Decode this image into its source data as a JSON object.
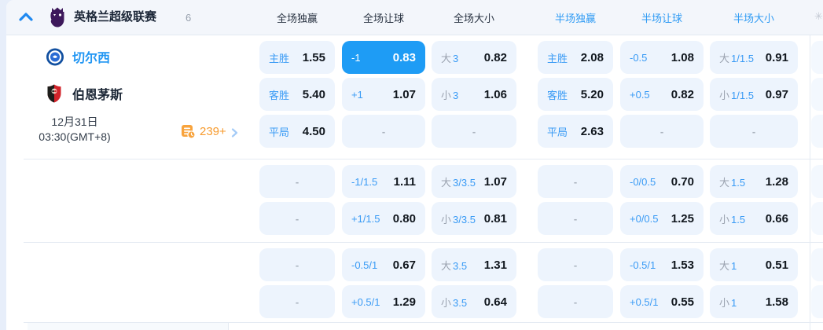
{
  "header": {
    "league_name": "英格兰超级联赛",
    "match_count": "6",
    "columns": [
      {
        "label": "全场独赢",
        "tone": "dark"
      },
      {
        "label": "全场让球",
        "tone": "dark"
      },
      {
        "label": "全场大小",
        "tone": "dark"
      },
      {
        "label": "半场独赢",
        "tone": "blue"
      },
      {
        "label": "半场让球",
        "tone": "blue"
      },
      {
        "label": "半场大小",
        "tone": "blue"
      }
    ]
  },
  "match": {
    "home_team": "切尔西",
    "away_team": "伯恩茅斯",
    "date": "12月31日",
    "time": "03:30(GMT+8)",
    "more_markets_count": "239+"
  },
  "odds": {
    "empty_label": "-",
    "rows": [
      [
        {
          "label": "主胜",
          "value": "1.55"
        },
        {
          "label": "-1",
          "value": "0.83",
          "highlight": true
        },
        {
          "prefix": "大",
          "label": "3",
          "value": "0.82"
        },
        {
          "label": "主胜",
          "value": "2.08"
        },
        {
          "label": "-0.5",
          "value": "1.08"
        },
        {
          "prefix": "大",
          "label": "1/1.5",
          "value": "0.91"
        }
      ],
      [
        {
          "label": "客胜",
          "value": "5.40"
        },
        {
          "label": "+1",
          "value": "1.07"
        },
        {
          "prefix": "小",
          "label": "3",
          "value": "1.06"
        },
        {
          "label": "客胜",
          "value": "5.20"
        },
        {
          "label": "+0.5",
          "value": "0.82"
        },
        {
          "prefix": "小",
          "label": "1/1.5",
          "value": "0.97"
        }
      ],
      [
        {
          "label": "平局",
          "value": "4.50"
        },
        {
          "empty": true
        },
        {
          "empty": true
        },
        {
          "label": "平局",
          "value": "2.63"
        },
        {
          "empty": true
        },
        {
          "empty": true
        }
      ],
      [
        {
          "empty": true
        },
        {
          "label": "-1/1.5",
          "value": "1.11"
        },
        {
          "prefix": "大",
          "label": "3/3.5",
          "value": "1.07"
        },
        {
          "empty": true
        },
        {
          "label": "-0/0.5",
          "value": "0.70"
        },
        {
          "prefix": "大",
          "label": "1.5",
          "value": "1.28"
        }
      ],
      [
        {
          "empty": true
        },
        {
          "label": "+1/1.5",
          "value": "0.80"
        },
        {
          "prefix": "小",
          "label": "3/3.5",
          "value": "0.81"
        },
        {
          "empty": true
        },
        {
          "label": "+0/0.5",
          "value": "1.25"
        },
        {
          "prefix": "小",
          "label": "1.5",
          "value": "0.66"
        }
      ],
      [
        {
          "empty": true
        },
        {
          "label": "-0.5/1",
          "value": "0.67"
        },
        {
          "prefix": "大",
          "label": "3.5",
          "value": "1.31"
        },
        {
          "empty": true
        },
        {
          "label": "-0.5/1",
          "value": "1.53"
        },
        {
          "prefix": "大",
          "label": "1",
          "value": "0.51"
        }
      ],
      [
        {
          "empty": true
        },
        {
          "label": "+0.5/1",
          "value": "1.29"
        },
        {
          "prefix": "小",
          "label": "3.5",
          "value": "0.64"
        },
        {
          "empty": true
        },
        {
          "label": "+0.5/1",
          "value": "0.55"
        },
        {
          "prefix": "小",
          "label": "1",
          "value": "1.58"
        }
      ]
    ]
  },
  "icons": {
    "collapse": "chevron-up-icon",
    "more_markets": "markets-list-clock-icon",
    "header_right": "settings-icon"
  },
  "colors": {
    "accent_blue": "#1e9cf5",
    "label_blue": "#3a9bf5",
    "header_bg": "#f3f6fb",
    "cell_bg": "#edf4fd",
    "orange": "#f79b2e",
    "dark_text": "#10161d",
    "gray_text": "#9aa2af",
    "pl_purple": "#3d195b"
  }
}
